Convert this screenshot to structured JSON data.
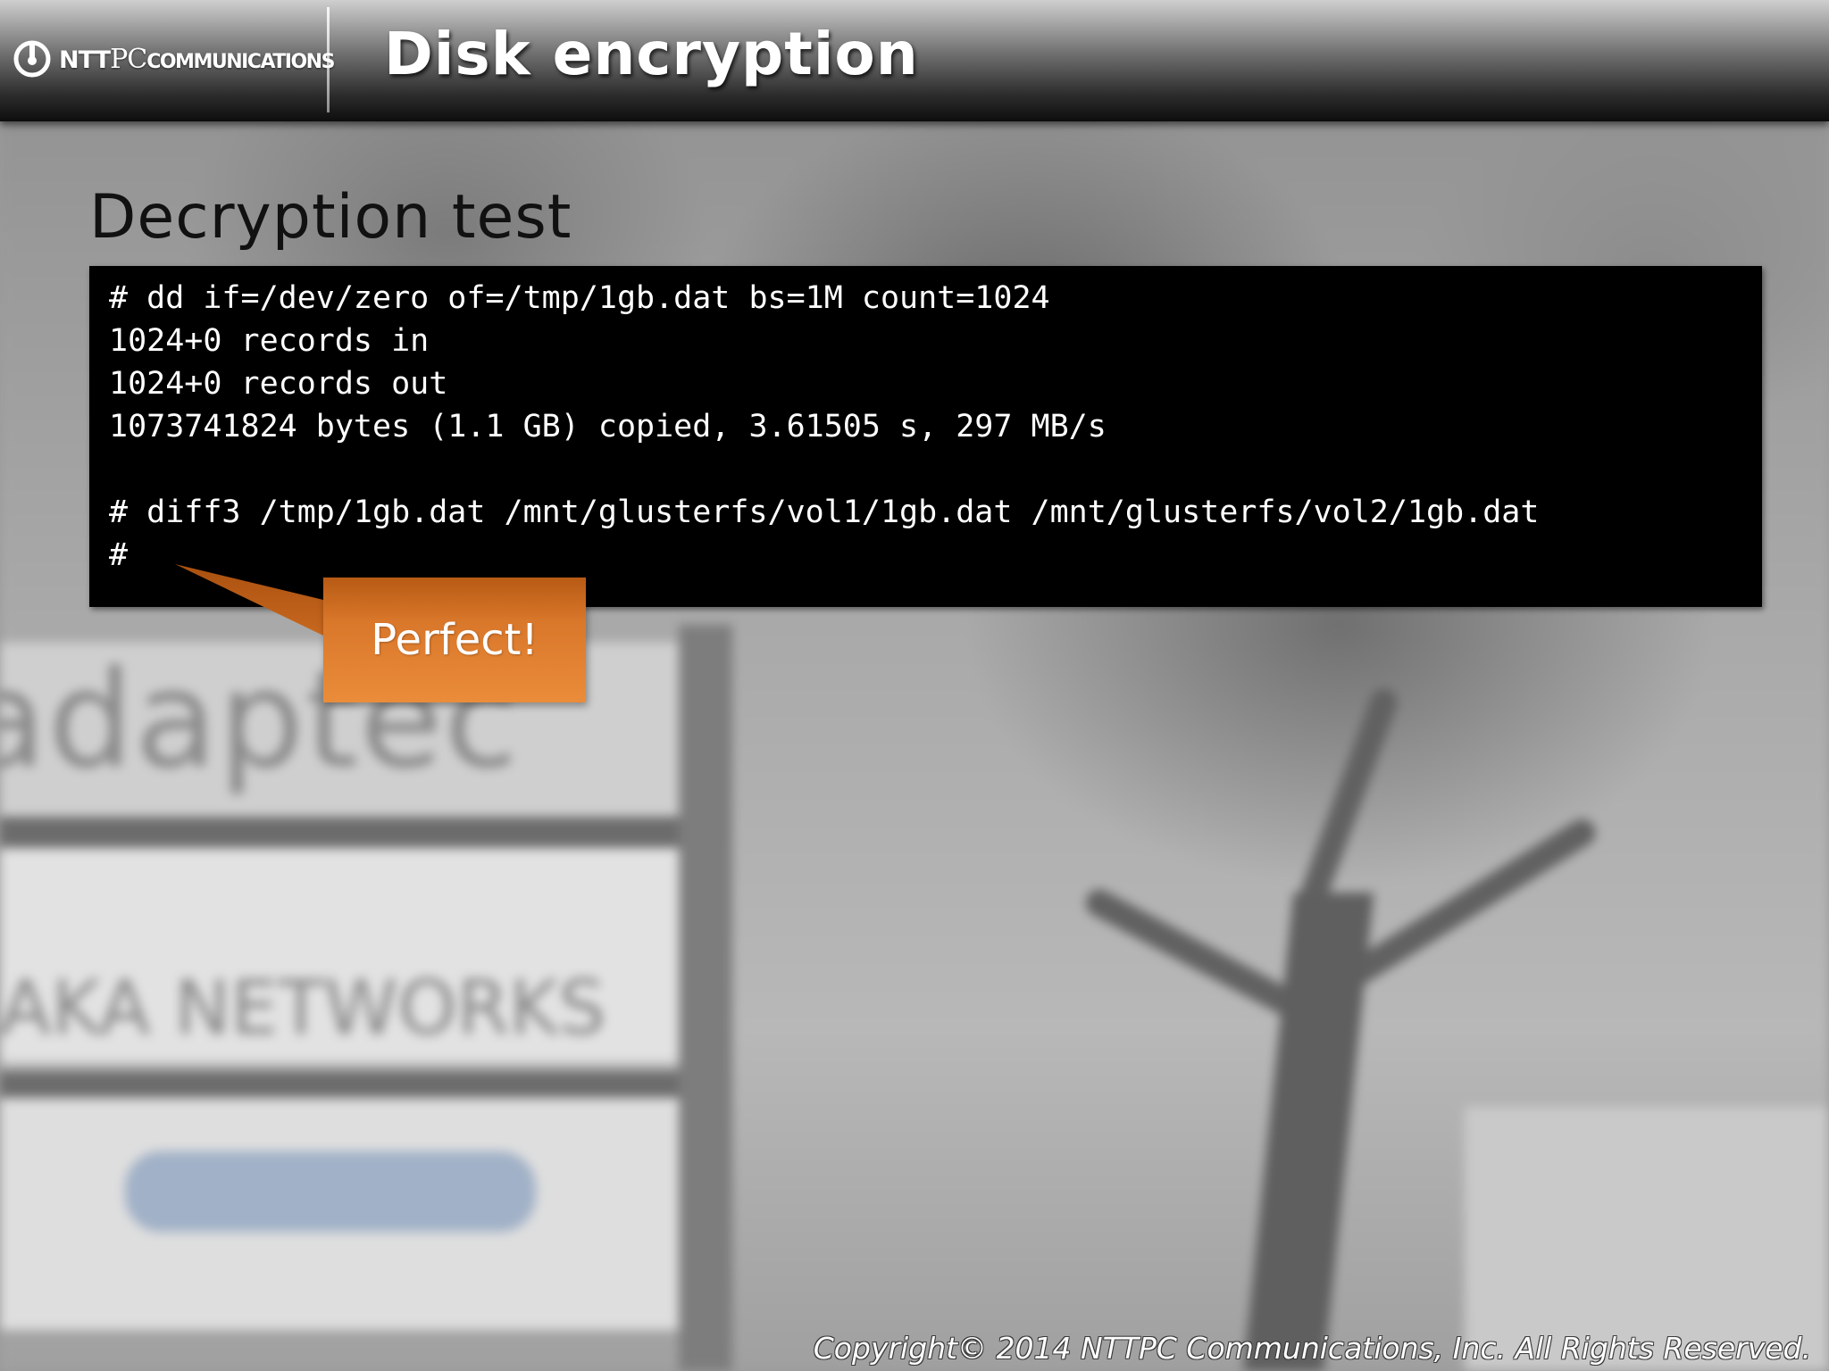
{
  "header": {
    "logo": {
      "brand": "NTT",
      "pc": "PC",
      "comm": "COMMUNICATIONS",
      "icon": "ntt-logo-icon"
    },
    "title": "Disk encryption"
  },
  "slide": {
    "subtitle": "Decryption test"
  },
  "terminal": {
    "lines": [
      "# dd if=/dev/zero of=/tmp/1gb.dat bs=1M count=1024",
      "1024+0 records in",
      "1024+0 records out",
      "1073741824 bytes (1.1 GB) copied, 3.61505 s, 297 MB/s",
      "",
      "# diff3 /tmp/1gb.dat /mnt/glusterfs/vol1/1gb.dat /mnt/glusterfs/vol2/1gb.dat",
      "#"
    ]
  },
  "callout": {
    "text": "Perfect!",
    "color": "#e8893a"
  },
  "footer": {
    "copyright": "Copyright© 2014 NTTPC Communications, Inc. All Rights Reserved."
  },
  "background": {
    "ghost_text": "adaptec",
    "ghost_text2": "AKA NETWORKS"
  }
}
